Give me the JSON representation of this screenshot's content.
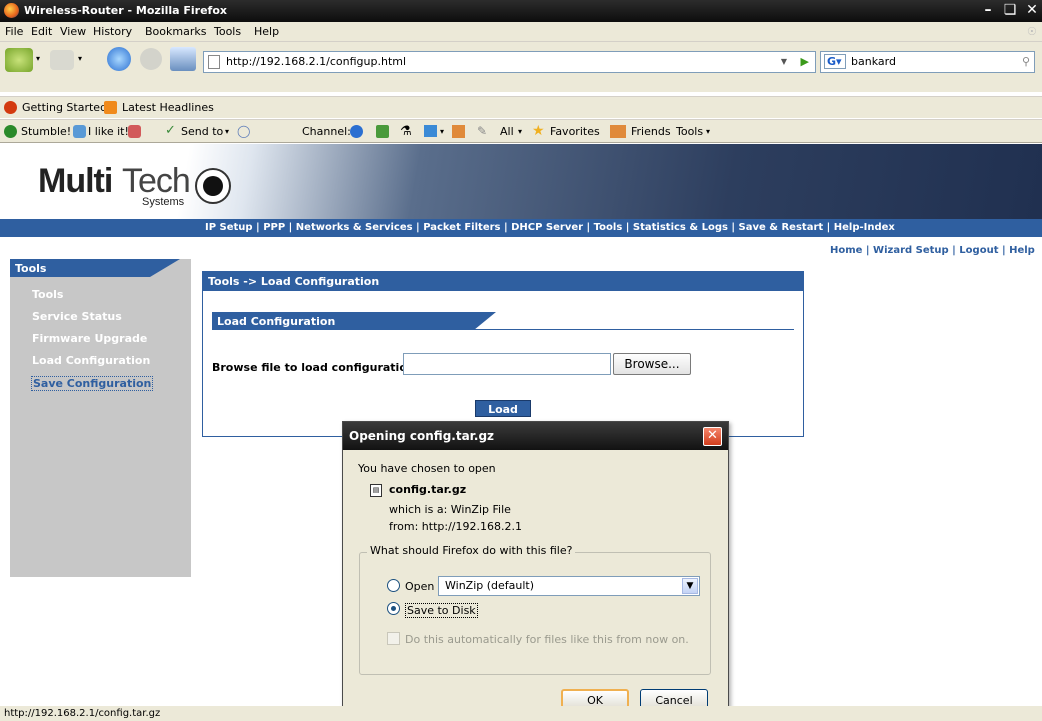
{
  "window": {
    "title": "Wireless-Router - Mozilla Firefox"
  },
  "menubar": {
    "items": [
      "File",
      "Edit",
      "View",
      "History",
      "Bookmarks",
      "Tools",
      "Help"
    ]
  },
  "navbar": {
    "url": "http://192.168.2.1/configup.html",
    "search_value": "bankard"
  },
  "bookmarks": {
    "items": [
      "Getting Started",
      "Latest Headlines"
    ]
  },
  "stumble": {
    "items": [
      "Stumble!",
      "I like it!",
      "Send to",
      "Channel:",
      "All",
      "Favorites",
      "Friends",
      "Tools"
    ]
  },
  "page": {
    "logo": {
      "brand_bold": "Multi",
      "brand_light": "Tech",
      "sub": "Systems"
    },
    "topnav": "IP Setup | PPP | Networks & Services | Packet Filters | DHCP Server | Tools | Statistics & Logs | Save & Restart | Help-Index",
    "subnav": "Home | Wizard Setup | Logout | Help",
    "sidebar": {
      "heading": "Tools",
      "items": [
        "Tools",
        "Service Status",
        "Firmware Upgrade",
        "Load Configuration",
        "Save Configuration"
      ]
    },
    "content": {
      "caption": "Tools -> Load Configuration",
      "section": "Load Configuration",
      "browse_label": "Browse file to load configuration",
      "browse_button": "Browse...",
      "load_button": "Load"
    }
  },
  "dialog": {
    "title": "Opening config.tar.gz",
    "intro": "You have chosen to open",
    "filename": "config.tar.gz",
    "which_is": "which is a:  WinZip File",
    "from": "from:  http://192.168.2.1",
    "question": "What should Firefox do with this file?",
    "open_with_label": "Open with",
    "open_with_value": "WinZip (default)",
    "save_to_disk_label": "Save to Disk",
    "auto_label": "Do this automatically for files like this from now on.",
    "ok": "OK",
    "cancel": "Cancel"
  },
  "statusbar": {
    "text": "http://192.168.2.1/config.tar.gz"
  }
}
